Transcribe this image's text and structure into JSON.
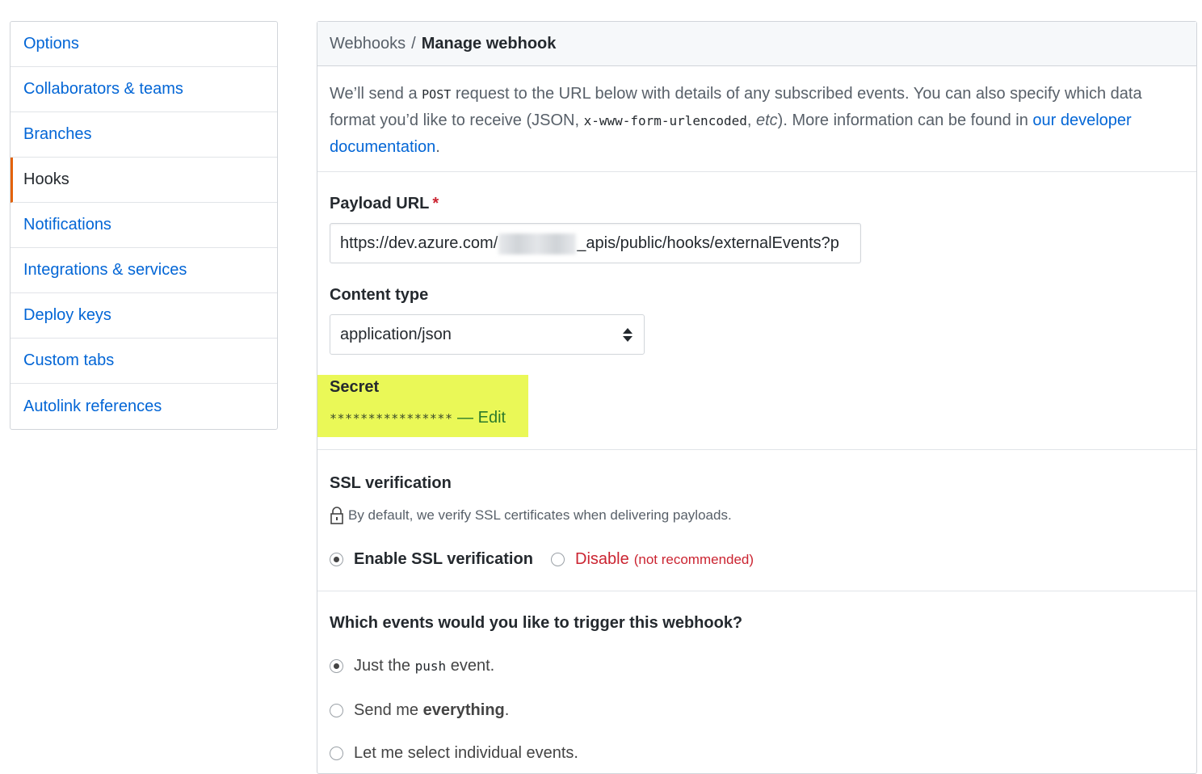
{
  "sidebar": {
    "items": [
      {
        "label": "Options"
      },
      {
        "label": "Collaborators & teams"
      },
      {
        "label": "Branches"
      },
      {
        "label": "Hooks",
        "selected": true
      },
      {
        "label": "Notifications"
      },
      {
        "label": "Integrations & services"
      },
      {
        "label": "Deploy keys"
      },
      {
        "label": "Custom tabs"
      },
      {
        "label": "Autolink references"
      }
    ]
  },
  "header": {
    "breadcrumb_parent": "Webhooks",
    "separator": "/",
    "title": "Manage webhook"
  },
  "intro": {
    "part1": "We’ll send a ",
    "code_post": "POST",
    "part2": " request to the URL below with details of any subscribed events. You can also specify which data format you’d like to receive (JSON, ",
    "code_format": "x-www-form-urlencoded",
    "part3": ", ",
    "etc": "etc",
    "part4": "). More information can be found in ",
    "link": "our developer documentation",
    "part5": "."
  },
  "payload": {
    "label": "Payload URL",
    "required_mark": "*",
    "value_prefix": "https://dev.azure.com/",
    "value_suffix": "_apis/public/hooks/externalEvents?p"
  },
  "content_type": {
    "label": "Content type",
    "selected": "application/json"
  },
  "secret": {
    "label": "Secret",
    "masked": "****************",
    "dash": " — ",
    "edit": "Edit",
    "highlight_color": "#eaf857"
  },
  "ssl": {
    "label": "SSL verification",
    "note": "By default, we verify SSL certificates when delivering payloads.",
    "enable_label": "Enable SSL verification",
    "disable_label": "Disable",
    "disable_note": "(not recommended)",
    "enabled": true
  },
  "events": {
    "question": "Which events would you like to trigger this webhook?",
    "opt1_a": "Just the ",
    "opt1_code": "push",
    "opt1_b": " event.",
    "opt2_a": "Send me ",
    "opt2_bold": "everything",
    "opt2_b": ".",
    "opt3": "Let me select individual events.",
    "selected": "push"
  },
  "colors": {
    "link": "#0366d6",
    "danger": "#cb2431",
    "selected_accent": "#e36209"
  }
}
